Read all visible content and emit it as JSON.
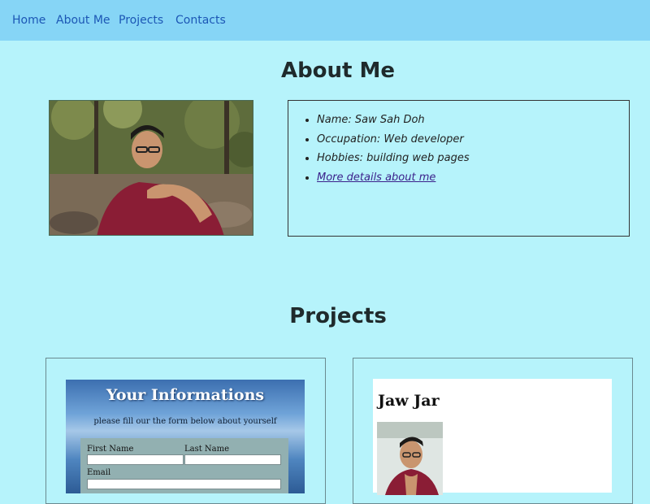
{
  "nav": {
    "home": "Home",
    "about": "About Me",
    "projects": "Projects",
    "contacts": "Contacts"
  },
  "about": {
    "title": "About Me",
    "items": [
      "Name: Saw Sah Doh",
      "Occupation: Web developer",
      "Hobbies: building web pages"
    ],
    "more_link": "More details about me"
  },
  "projects": {
    "title": "Projects",
    "form_project": {
      "title": "Your Informations",
      "subtitle": "please fill our the form below about yourself",
      "first_name_label": "First Name",
      "last_name_label": "Last Name",
      "email_label": "Email"
    },
    "profile_project": {
      "name": "Jaw Jar"
    }
  },
  "colors": {
    "page_background": "#b6f3fb",
    "navbar_background": "#86d5f6",
    "nav_link": "#1c57b5"
  }
}
